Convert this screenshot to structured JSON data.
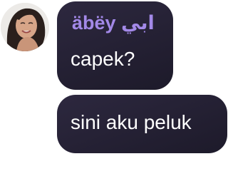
{
  "thread": {
    "avatar_icon": "user-photo-avatar",
    "messages": [
      {
        "sender": "äbëy ابي",
        "text": "capek?"
      },
      {
        "text": "sini aku peluk"
      }
    ]
  },
  "colors": {
    "bubble": "#231f33",
    "sender_name": "#a389e8",
    "message_text": "#ffffff",
    "background": "#ffffff"
  }
}
